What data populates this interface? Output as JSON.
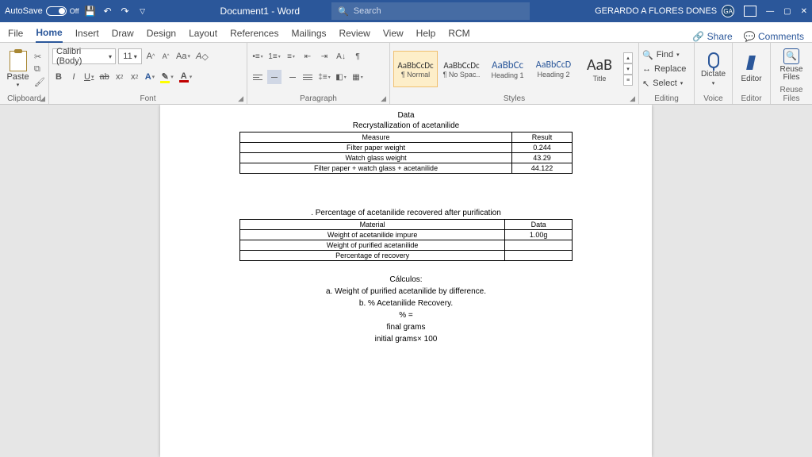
{
  "titlebar": {
    "autosave_label": "AutoSave",
    "autosave_state": "Off",
    "doc_title": "Document1 - Word",
    "search_placeholder": "Search",
    "user_name": "GERARDO A FLORES DONES",
    "user_initials": "GA"
  },
  "tabs": {
    "items": [
      "File",
      "Home",
      "Insert",
      "Draw",
      "Design",
      "Layout",
      "References",
      "Mailings",
      "Review",
      "View",
      "Help",
      "RCM"
    ],
    "active": "Home",
    "share": "Share",
    "comments": "Comments"
  },
  "ribbon": {
    "clipboard": {
      "paste": "Paste",
      "label": "Clipboard"
    },
    "font": {
      "name": "Calibri (Body)",
      "size": "11",
      "label": "Font"
    },
    "paragraph": {
      "label": "Paragraph"
    },
    "styles": {
      "label": "Styles",
      "items": [
        {
          "preview": "AaBbCcDc",
          "name": "¶ Normal",
          "selected": true,
          "size": "11px",
          "color": "#333"
        },
        {
          "preview": "AaBbCcDc",
          "name": "¶ No Spac..",
          "selected": false,
          "size": "11px",
          "color": "#333"
        },
        {
          "preview": "AaBbCc",
          "name": "Heading 1",
          "selected": false,
          "size": "13px",
          "color": "#2b579a"
        },
        {
          "preview": "AaBbCcD",
          "name": "Heading 2",
          "selected": false,
          "size": "12px",
          "color": "#2b579a"
        },
        {
          "preview": "AaB",
          "name": "Title",
          "selected": false,
          "size": "20px",
          "color": "#333"
        }
      ]
    },
    "editing": {
      "find": "Find",
      "replace": "Replace",
      "select": "Select",
      "label": "Editing"
    },
    "voice": {
      "dictate": "Dictate",
      "label": "Voice"
    },
    "editor": {
      "btn": "Editor",
      "label": "Editor"
    },
    "reuse": {
      "btn": "Reuse Files",
      "label": "Reuse Files"
    }
  },
  "document": {
    "title1": "Data",
    "subtitle1": "Recrystallization of acetanilide",
    "table1": {
      "headers": [
        "Measure",
        "Result"
      ],
      "rows": [
        [
          "Filter paper weight",
          "0.244"
        ],
        [
          "Watch glass weight",
          "43.29"
        ],
        [
          "Filter paper + watch glass + acetanilide",
          "44.122"
        ]
      ]
    },
    "subtitle2": ". Percentage of acetanilide recovered after purification",
    "table2": {
      "headers": [
        "Material",
        "Data"
      ],
      "rows": [
        [
          "Weight of acetanilide impure",
          "1.00g"
        ],
        [
          "Weight of purified acetanilide",
          ""
        ],
        [
          "Percentage of recovery",
          ""
        ]
      ]
    },
    "calc_header": "Cálculos:",
    "calc_a": "a. Weight of purified acetanilide by difference.",
    "calc_b": "b. % Acetanilide Recovery.",
    "calc_pct": "% =",
    "calc_final": "final grams",
    "calc_initial": "initial grams× 100"
  }
}
